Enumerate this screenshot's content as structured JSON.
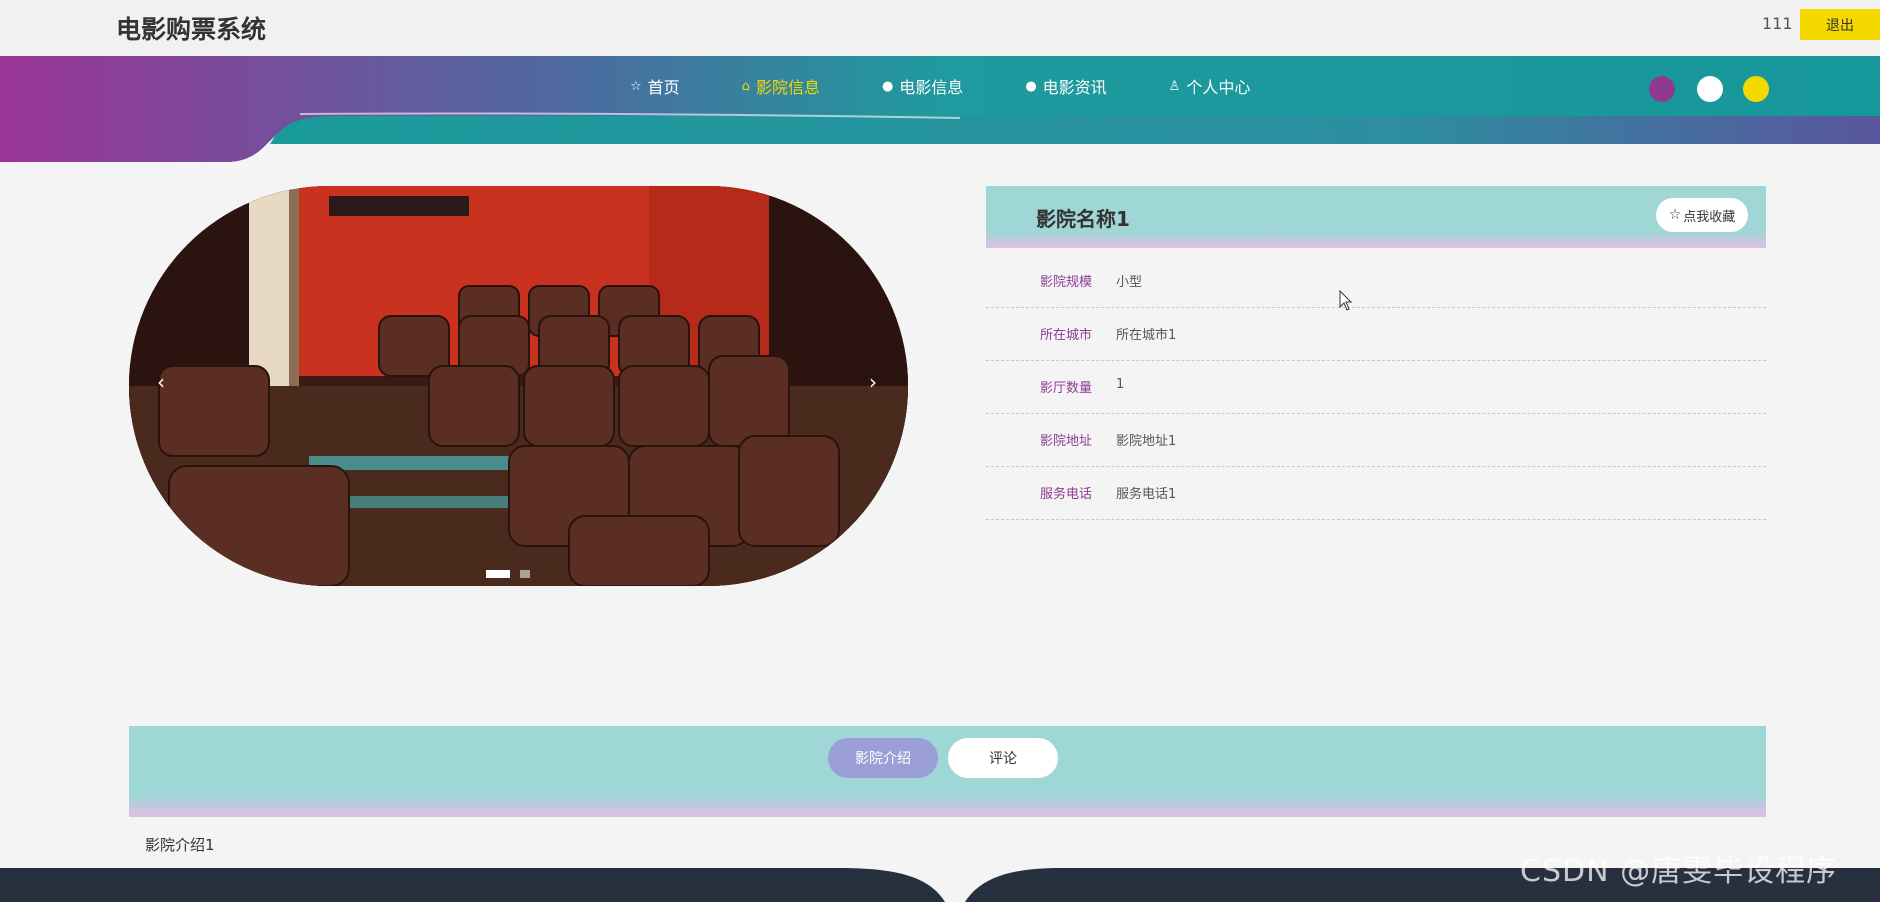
{
  "header": {
    "site_title": "电影购票系统",
    "username": "111",
    "logout_label": "退出"
  },
  "nav": {
    "items": [
      {
        "label": "首页",
        "icon": "star-icon"
      },
      {
        "label": "影院信息",
        "icon": "bag-icon",
        "active": true
      },
      {
        "label": "电影信息",
        "icon": "info-icon"
      },
      {
        "label": "电影资讯",
        "icon": "info-icon"
      },
      {
        "label": "个人中心",
        "icon": "user-icon"
      }
    ],
    "theme_colors": [
      "#8e3a93",
      "#ffffff",
      "#f5d800"
    ]
  },
  "carousel": {
    "prev_symbol": "‹",
    "next_symbol": "›",
    "slide_count": 2,
    "active_index": 0
  },
  "cinema": {
    "name": "影院名称1",
    "favorite_label": "点我收藏",
    "fields": [
      {
        "label": "影院规模",
        "value": "小型"
      },
      {
        "label": "所在城市",
        "value": "所在城市1"
      },
      {
        "label": "影厅数量",
        "value": "1"
      },
      {
        "label": "影院地址",
        "value": "影院地址1"
      },
      {
        "label": "服务电话",
        "value": "服务电话1"
      }
    ]
  },
  "tabs": {
    "intro_label": "影院介绍",
    "comments_label": "评论",
    "active": "intro"
  },
  "intro_text": "影院介绍1",
  "watermark": "CSDN @唐雯毕设程序",
  "colors": {
    "teal": "#1a9b9b",
    "purple": "#8e3a93",
    "yellow": "#f5d800",
    "footer_navy": "#26303f"
  }
}
